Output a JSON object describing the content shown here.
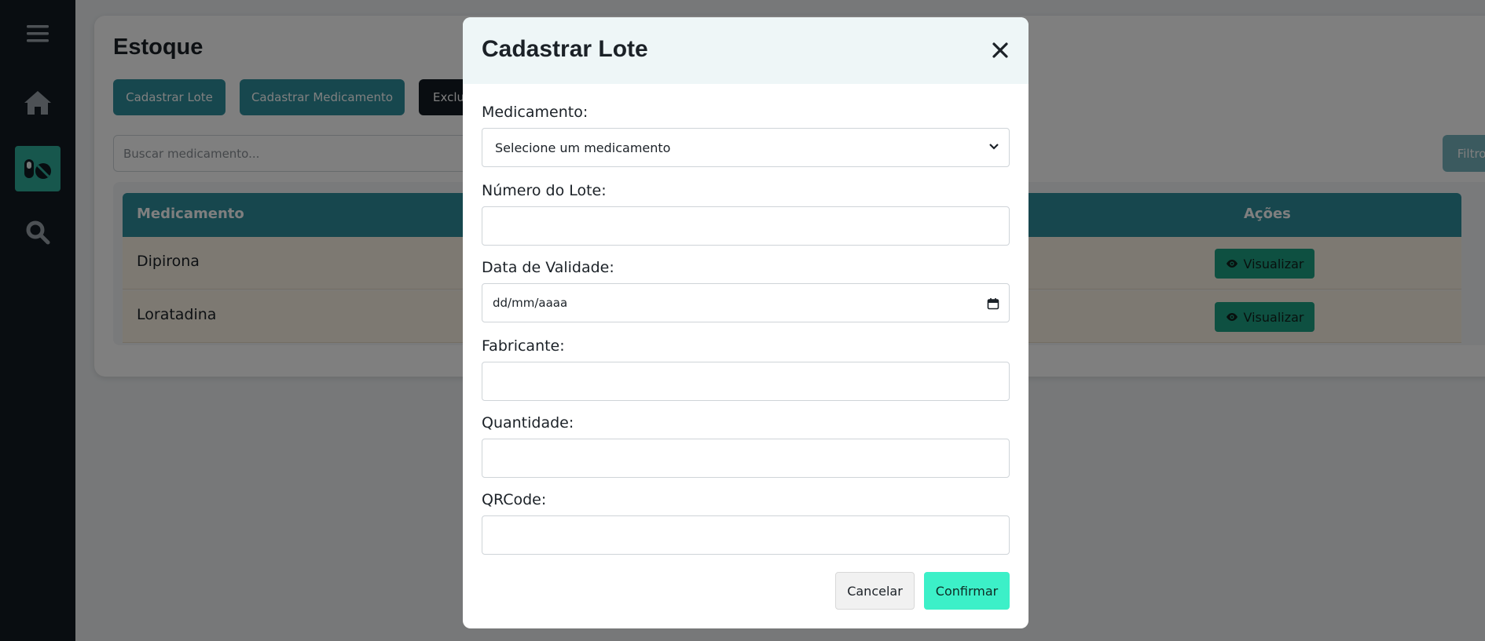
{
  "sidebar": {
    "items": [
      {
        "icon": "menu-icon"
      },
      {
        "icon": "home-icon"
      },
      {
        "icon": "pills-icon",
        "active": true
      },
      {
        "icon": "search-icon"
      }
    ],
    "active_color": "#2eae9b"
  },
  "page": {
    "title": "Estoque",
    "buttons": {
      "cadastrar_lote": "Cadastrar Lote",
      "cadastrar_medicamento": "Cadastrar Medicamento",
      "excluir": "Excluir"
    },
    "search_placeholder": "Buscar medicamento...",
    "filtros_label": "Filtros",
    "table": {
      "headers": {
        "medicamento": "Medicamento",
        "acoes": "Ações"
      },
      "rows": [
        {
          "medicamento": "Dipirona",
          "action": "Visualizar"
        },
        {
          "medicamento": "Loratadina",
          "action": "Visualizar"
        }
      ]
    },
    "accent_color": "#2f8f9d"
  },
  "modal": {
    "title": "Cadastrar Lote",
    "fields": {
      "medicamento_label": "Medicamento:",
      "medicamento_value": "Selecione um medicamento",
      "numero_lote_label": "Número do Lote:",
      "data_validade_label": "Data de Validade:",
      "data_validade_placeholder": "dd/mm/aaaa",
      "fabricante_label": "Fabricante:",
      "quantidade_label": "Quantidade:",
      "qrcode_label": "QRCode:"
    },
    "cancel_label": "Cancelar",
    "confirm_label": "Confirmar",
    "confirm_color": "#3cf0c8"
  }
}
